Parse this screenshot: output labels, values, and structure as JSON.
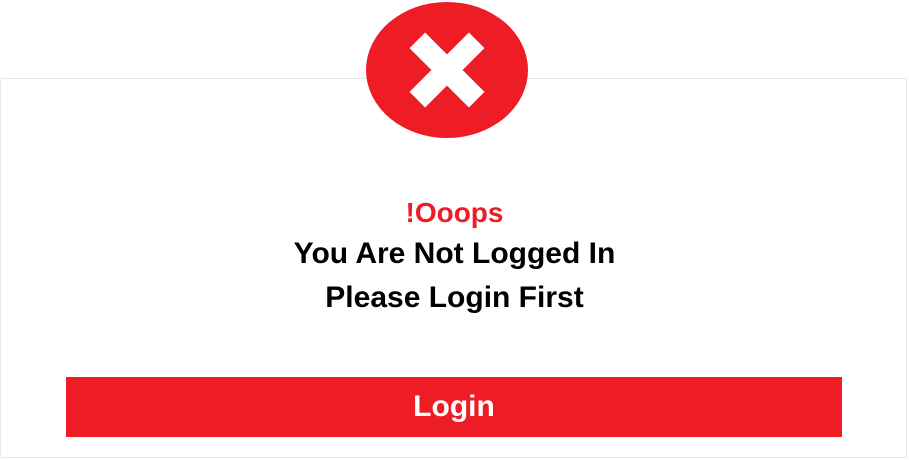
{
  "dialog": {
    "icon": "close-x-icon",
    "heading": "!Ooops",
    "message_line1": "You Are Not Logged In",
    "message_line2": "Please Login First",
    "login_button_label": "Login"
  },
  "colors": {
    "accent": "#ee1c25",
    "text": "#000000",
    "background": "#ffffff"
  }
}
